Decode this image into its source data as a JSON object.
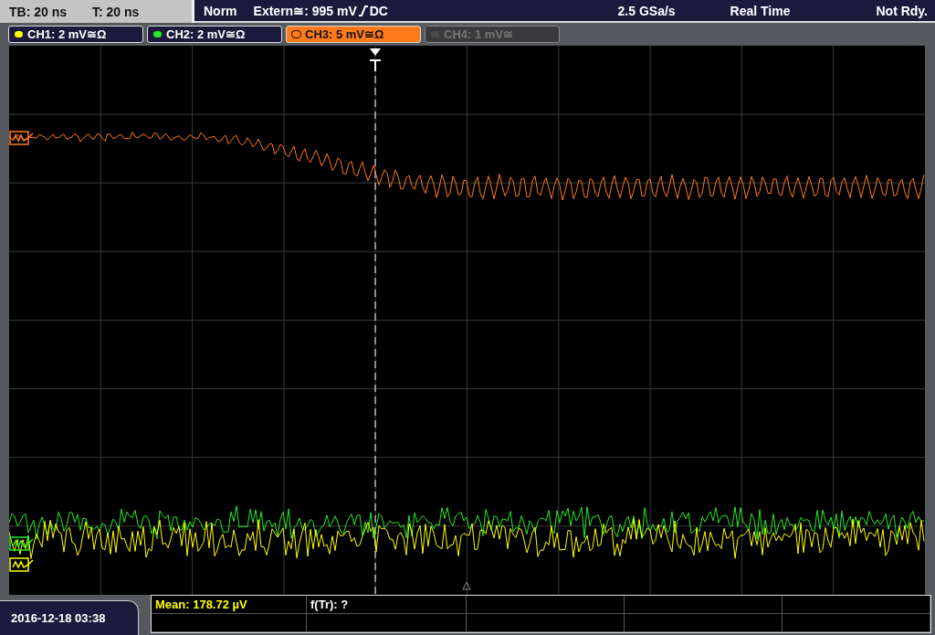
{
  "status": {
    "timebase": "TB: 20 ns",
    "trigger_time": "T: 20 ns"
  },
  "acquisition": {
    "trigger_mode": "Norm",
    "trigger_source": "Extern≅: 995 mV",
    "coupling": "DC",
    "sample_rate": "2.5 GSa/s",
    "acquisition_mode": "Real Time",
    "state": "Not Rdy."
  },
  "channels": [
    {
      "label": "CH1: 2 mV≅Ω",
      "color": "#ffff00",
      "selected": false,
      "disabled": false
    },
    {
      "label": "CH2: 2 mV≅Ω",
      "color": "#22ee22",
      "selected": false,
      "disabled": false
    },
    {
      "label": "CH3: 5 mV≅Ω",
      "color": "#ff7a1a",
      "selected": true,
      "disabled": false
    },
    {
      "label": "CH4: 1 mV≅",
      "color": "#4a4a4a",
      "selected": false,
      "disabled": true
    }
  ],
  "measurements": [
    "Mean: 178.72 µV",
    "f(Tr): ?"
  ],
  "datetime": "2016-12-18 03:38"
}
